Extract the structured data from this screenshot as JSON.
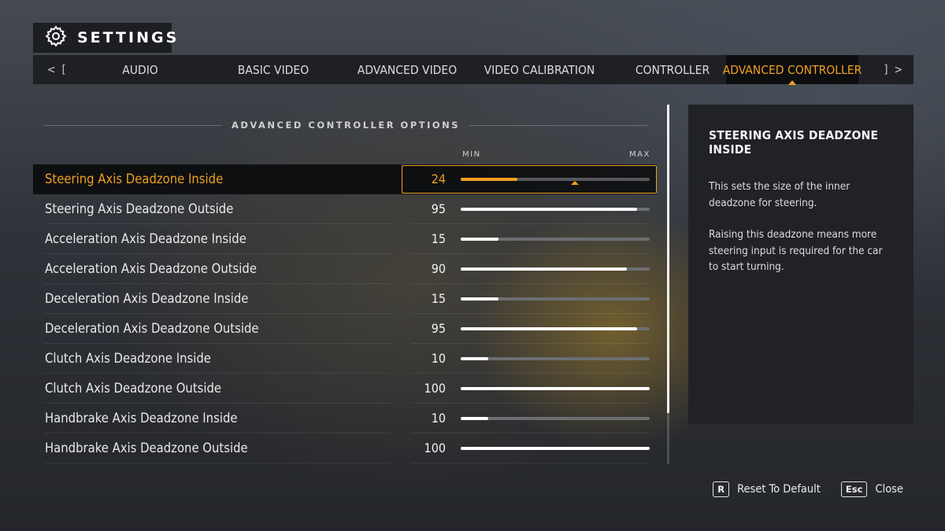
{
  "header": {
    "title": "SETTINGS",
    "icon": "gear-icon"
  },
  "tabs": {
    "nav_left": "<",
    "nav_left_bracket": "[",
    "nav_right_bracket": "]",
    "nav_right": ">",
    "items": [
      {
        "label": "AUDIO"
      },
      {
        "label": "BASIC VIDEO"
      },
      {
        "label": "ADVANCED VIDEO"
      },
      {
        "label": "VIDEO CALIBRATION"
      },
      {
        "label": "CONTROLLER"
      },
      {
        "label": "ADVANCED CONTROLLER",
        "active": true
      }
    ]
  },
  "section": {
    "title": "ADVANCED CONTROLLER OPTIONS",
    "min_label": "MIN",
    "max_label": "MAX"
  },
  "options": [
    {
      "label": "Steering Axis Deadzone Inside",
      "value": "24",
      "level": 0.3,
      "selected": true
    },
    {
      "label": "Steering Axis Deadzone Outside",
      "value": "95",
      "level": 0.935
    },
    {
      "label": "Acceleration Axis Deadzone Inside",
      "value": "15",
      "level": 0.2
    },
    {
      "label": "Acceleration Axis Deadzone Outside",
      "value": "90",
      "level": 0.88
    },
    {
      "label": "Deceleration Axis Deadzone Inside",
      "value": "15",
      "level": 0.2
    },
    {
      "label": "Deceleration Axis Deadzone Outside",
      "value": "95",
      "level": 0.935
    },
    {
      "label": "Clutch Axis Deadzone Inside",
      "value": "10",
      "level": 0.145
    },
    {
      "label": "Clutch Axis Deadzone Outside",
      "value": "100",
      "level": 1.0
    },
    {
      "label": "Handbrake Axis Deadzone Inside",
      "value": "10",
      "level": 0.145
    },
    {
      "label": "Handbrake Axis Deadzone Outside",
      "value": "100",
      "level": 1.0
    }
  ],
  "info": {
    "title": "STEERING AXIS DEADZONE INSIDE",
    "paragraphs": [
      "This sets the size of the inner deadzone for steering.",
      "Raising this deadzone means more steering input is required for the car to start turning."
    ]
  },
  "footer": {
    "reset_key": "R",
    "reset_label": "Reset To Default",
    "close_key": "Esc",
    "close_label": "Close"
  },
  "colors": {
    "accent": "#f0a020",
    "panel": "#202226",
    "tabbar": "#1e2024"
  }
}
